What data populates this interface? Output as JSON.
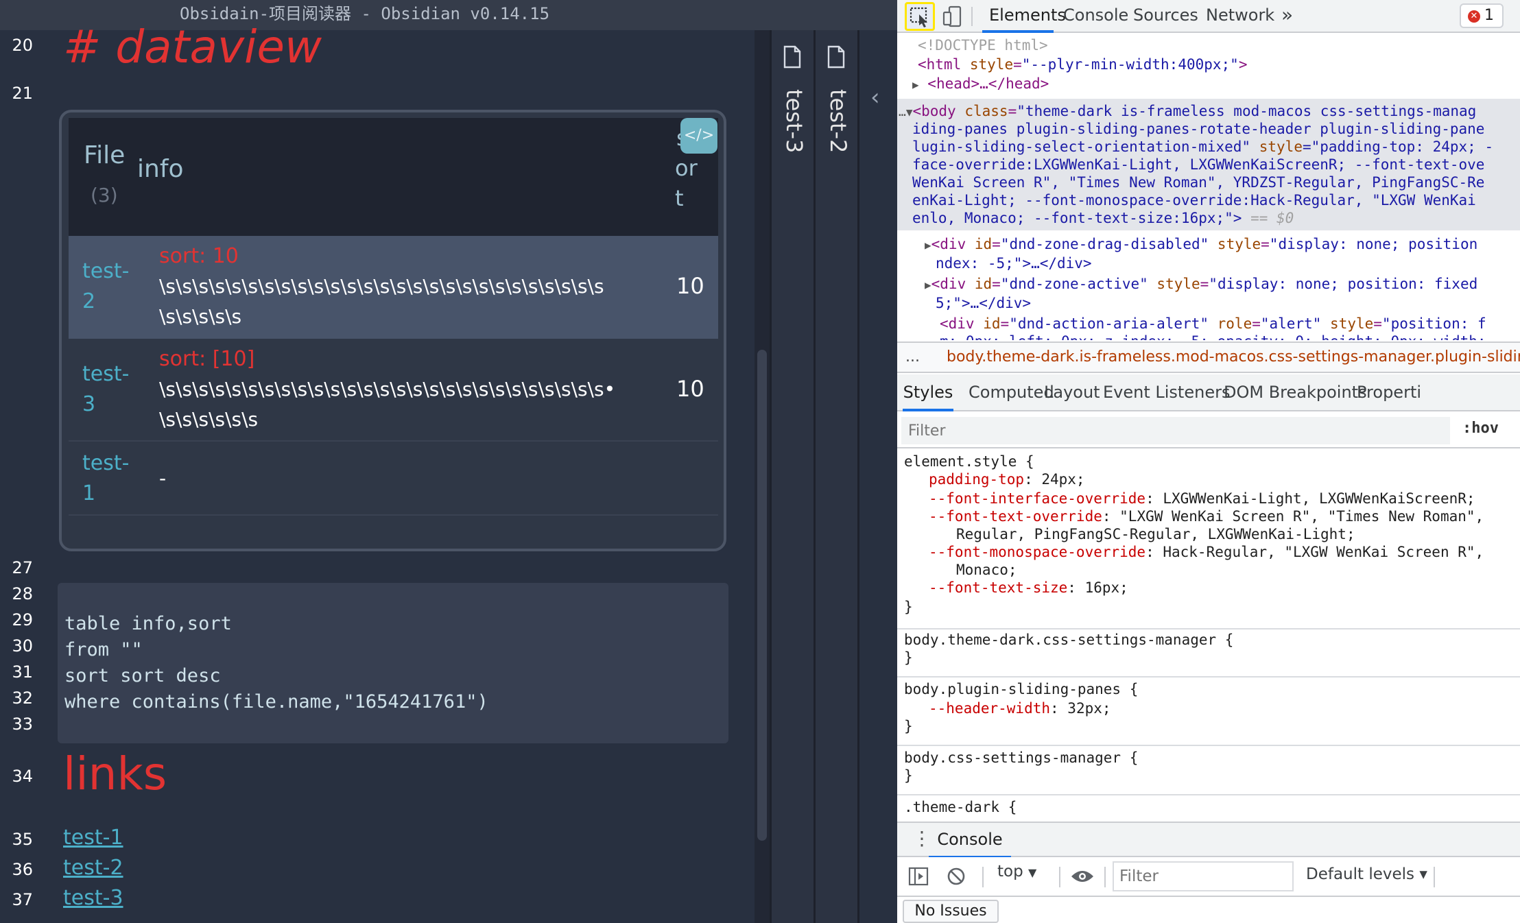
{
  "window": {
    "title": "Obsidain-项目阅读器 - Obsidian v0.14.15"
  },
  "editor": {
    "line_numbers": {
      "l20": "20",
      "l21": "21",
      "l27": "27",
      "l28": "28",
      "l29": "29",
      "l30": "30",
      "l31": "31",
      "l32": "32",
      "l33": "33",
      "l34": "34",
      "l35": "35",
      "l36": "36",
      "l37": "37"
    },
    "heading_dataview": "# dataview",
    "heading_links": "links",
    "dataview_table": {
      "headers": {
        "file": "File",
        "file_count": "(3)",
        "info": "info",
        "sort_l1": "s",
        "sort_l2": "or",
        "sort_l3": "t"
      },
      "rows": [
        {
          "file_l1": "test-",
          "file_l2": "2",
          "info_red": "sort: 10",
          "info_l1": "\\s\\s\\s\\s\\s\\s\\s\\s\\s\\s\\s\\s\\s\\s\\s\\s\\s\\s\\s\\s\\s\\s\\s\\s\\s\\s\\s",
          "info_l2": "\\s\\s\\s\\s\\s",
          "sort": "10"
        },
        {
          "file_l1": "test-",
          "file_l2": "3",
          "info_red": "sort: [10]",
          "info_l1": "\\s\\s\\s\\s\\s\\s\\s\\s\\s\\s\\s\\s\\s\\s\\s\\s\\s\\s\\s\\s\\s\\s\\s\\s\\s\\s\\s•",
          "info_l2": "\\s\\s\\s\\s\\s\\s",
          "sort": "10"
        },
        {
          "file_l1": "test-",
          "file_l2": "1",
          "info": "-",
          "sort": ""
        }
      ]
    },
    "code_lines": {
      "c29": "table info,sort",
      "c30": "from \"\"",
      "c31": "sort sort desc",
      "c32": "where contains(file.name,\"1654241761\")"
    },
    "links": [
      "test-1",
      "test-2",
      "test-3"
    ],
    "tabs": {
      "t3": "test-3",
      "t2": "test-2"
    }
  },
  "devtools": {
    "tabs": {
      "elements": "Elements",
      "console": "Console",
      "sources": "Sources",
      "network": "Network",
      "more": "»"
    },
    "error_count": "1",
    "dom": {
      "doctype": "<!DOCTYPE html>",
      "html_open": "<html",
      "html_attr": "style",
      "html_val": "\"--plyr-min-width:400px;\"",
      "html_close": ">",
      "head_collapsed": "<head>…</head>",
      "body_tag": "<body",
      "body_class_attr": "class",
      "body_class_val": "\"theme-dark is-frameless mod-macos css-settings-manag",
      "body_l2": "iding-panes plugin-sliding-panes-rotate-header plugin-sliding-pane",
      "body_l3a": "lugin-sliding-select-orientation-mixed\"",
      "body_l3b": "style",
      "body_l3c": "=\"padding-top: 24px; -",
      "body_l4": "face-override:LXGWWenKai-Light, LXGWWenKaiScreenR; --font-text-ove",
      "body_l5": "WenKai Screen R\", \"Times New Roman\", YRDZST-Regular, PingFangSC-Re",
      "body_l6": "enKai-Light; --font-monospace-override:Hack-Regular, \"LXGW WenKai",
      "body_l7": "enlo, Monaco; --font-text-size:16px;\">",
      "body_eq": " == $0",
      "div1_tag": "<div",
      "div1_id": "id",
      "div1_idv": "\"dnd-zone-drag-disabled\"",
      "div1_style": "style",
      "div1_stylev": "\"display: none; position",
      "div1_l2": "ndex: -5;\">…</div>",
      "div2_tag": "<div",
      "div2_id": "id",
      "div2_idv": "\"dnd-zone-active\"",
      "div2_style": "style",
      "div2_stylev": "\"display: none; position: fixed",
      "div2_l2": "5;\">…</div>",
      "div3_tag": "<div",
      "div3_id": "id",
      "div3_idv": "\"dnd-action-aria-alert\"",
      "div3_role": "role",
      "div3_rolev": "\"alert\"",
      "div3_style": "style",
      "div3_stylev": "\"position: f",
      "div3_l2": "m: 0px; left: 0px; z-index: -5; opacity: 0; height: 0px; width:"
    },
    "breadcrumb": "body.theme-dark.is-frameless.mod-macos.css-settings-manager.plugin-sliding",
    "breadcrumb_dots": "...",
    "subtabs": {
      "styles": "Styles",
      "computed": "Computed",
      "layout": "Layout",
      "events": "Event Listeners",
      "dom_bp": "DOM Breakpoints",
      "props": "Properti"
    },
    "styles_filter_placeholder": "Filter",
    "hov": ":hov",
    "styles": {
      "element_style": "element.style {",
      "p1_name": "padding-top",
      "p1_val": ": 24px;",
      "p2_name": "--font-interface-override",
      "p2_val": ": LXGWWenKai-Light, LXGWWenKaiScreenR;",
      "p3_name": "--font-text-override",
      "p3_val": ": \"LXGW WenKai Screen R\", \"Times New Roman\",",
      "p3_cont": "Regular, PingFangSC-Regular, LXGWWenKai-Light;",
      "p4_name": "--font-monospace-override",
      "p4_val": ": Hack-Regular, \"LXGW WenKai Screen R\",",
      "p4_cont": "Monaco;",
      "p5_name": "--font-text-size",
      "p5_val": ": 16px;",
      "close": "}",
      "rule2": "body.theme-dark.css-settings-manager {",
      "rule3": "body.plugin-sliding-panes {",
      "rule3_p_name": "--header-width",
      "rule3_p_val": ": 32px;",
      "rule4": "body.css-settings-manager {",
      "rule5": ".theme-dark {"
    },
    "console": {
      "tab": "Console",
      "context": "top",
      "filter_placeholder": "Filter",
      "levels": "Default levels ▾",
      "issues": "No Issues"
    }
  }
}
